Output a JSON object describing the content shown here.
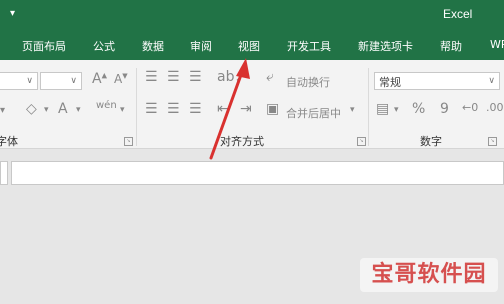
{
  "window": {
    "app_title": "Excel",
    "qat_glyph": "▾"
  },
  "tabs": [
    {
      "label": "页面布局"
    },
    {
      "label": "公式"
    },
    {
      "label": "数据"
    },
    {
      "label": "审阅"
    },
    {
      "label": "视图"
    },
    {
      "label": "开发工具"
    },
    {
      "label": "新建选项卡"
    },
    {
      "label": "帮助"
    },
    {
      "label": "WP"
    }
  ],
  "ribbon": {
    "font_group": {
      "label": "字体",
      "launcher": "↘"
    },
    "alignment_group": {
      "label": "对齐方式",
      "wrap_text_label": "自动换行",
      "merge_center_label": "合并后居中",
      "launcher": "↘"
    },
    "number_group": {
      "label": "数字",
      "format_value": "常规",
      "percent_glyph": "%",
      "comma_glyph": "9",
      "launcher": "↘"
    }
  },
  "watermark": {
    "text": "宝哥软件园"
  },
  "colors": {
    "ribbon_green": "#217346",
    "annotation_arrow": "#d9312f",
    "watermark": "#d6504f"
  },
  "icons": [
    "fill-color-icon",
    "font-color-icon",
    "phonetic-icon",
    "align-left-icon",
    "align-center-icon",
    "align-right-icon",
    "orientation-icon",
    "wrap-text-icon",
    "merge-center-icon",
    "currency-icon",
    "percent-icon",
    "comma-icon",
    "decrease-indent-icon",
    "increase-indent-icon"
  ]
}
